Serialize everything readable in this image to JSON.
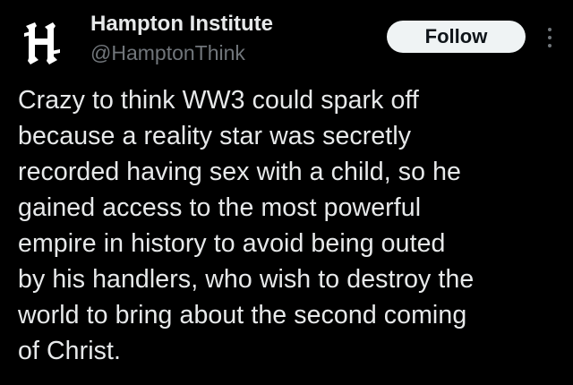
{
  "author": {
    "display_name": "Hampton Institute",
    "handle": "@HamptonThink",
    "avatar_icon": "hampton-h-logo-icon"
  },
  "actions": {
    "follow_label": "Follow",
    "more_icon": "more-vertical-icon"
  },
  "tweet": {
    "text": "Crazy to think WW3 could spark off\nbecause a reality star was secretly\nrecorded having sex with a child, so he\ngained access to the most powerful\nempire in history to avoid being outed\nby his handlers, who wish to destroy the\nworld to bring about the second coming\nof Christ."
  },
  "colors": {
    "background": "#000000",
    "primary_text": "#e7e9ea",
    "secondary_text": "#71767b",
    "follow_button_bg": "#eff3f4",
    "follow_button_text": "#0f1419"
  }
}
